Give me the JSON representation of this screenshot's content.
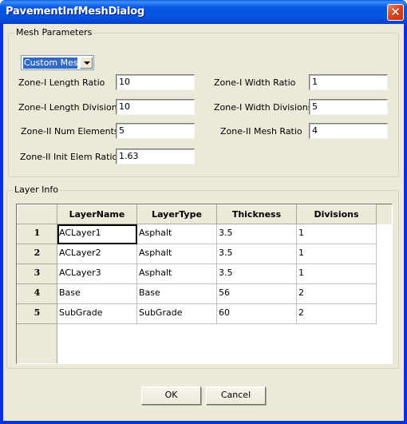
{
  "window": {
    "title": "PavementInfMeshDialog",
    "close_icon": "close-x-icon"
  },
  "mesh_parameters": {
    "legend": "Mesh Parameters",
    "mesh_type": {
      "selected": "Custom Mesh",
      "icon": "chevron-down-icon"
    },
    "fields": {
      "zone1_length_ratio": {
        "label": "Zone-I Length Ratio",
        "value": "10"
      },
      "zone1_width_ratio": {
        "label": "Zone-I Width Ratio",
        "value": "1"
      },
      "zone1_length_divisions": {
        "label": "Zone-I Length Divisions",
        "value": "10"
      },
      "zone1_width_divisions": {
        "label": "Zone-I Width Divisions",
        "value": "5"
      },
      "zone2_num_elements": {
        "label": "Zone-II Num Elements",
        "value": "5"
      },
      "zone2_mesh_ratio": {
        "label": "Zone-II Mesh Ratio",
        "value": "4"
      },
      "zone2_init_elem_ratio": {
        "label": "Zone-II Init Elem Ratio",
        "value": "1.63"
      }
    }
  },
  "layer_info": {
    "legend": "Layer Info",
    "columns": [
      "LayerName",
      "LayerType",
      "Thickness",
      "Divisions"
    ],
    "rows": [
      {
        "index": "1",
        "name": "ACLayer1",
        "type": "Asphalt",
        "thickness": "3.5",
        "divisions": "1"
      },
      {
        "index": "2",
        "name": "ACLayer2",
        "type": "Asphalt",
        "thickness": "3.5",
        "divisions": "1"
      },
      {
        "index": "3",
        "name": "ACLayer3",
        "type": "Asphalt",
        "thickness": "3.5",
        "divisions": "1"
      },
      {
        "index": "4",
        "name": "Base",
        "type": "Base",
        "thickness": "56",
        "divisions": "2"
      },
      {
        "index": "5",
        "name": "SubGrade",
        "type": "SubGrade",
        "thickness": "60",
        "divisions": "2"
      }
    ]
  },
  "buttons": {
    "ok": "OK",
    "cancel": "Cancel"
  }
}
